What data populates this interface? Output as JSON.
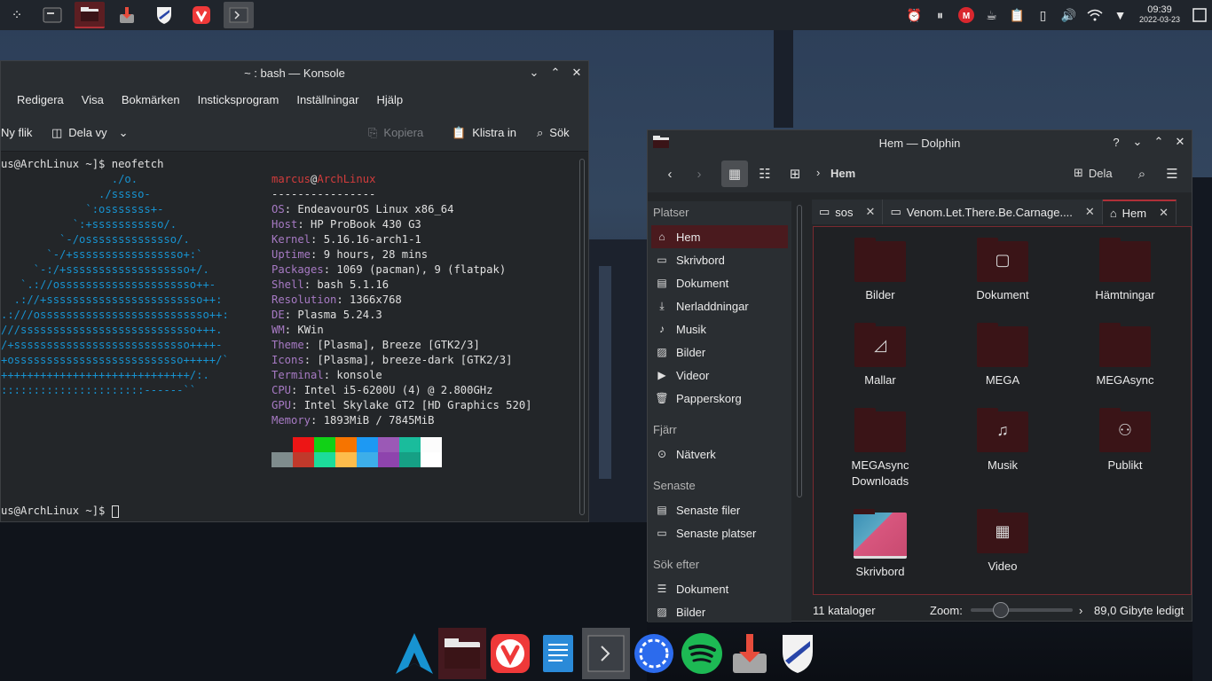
{
  "top_panel": {
    "launcher_icon": "kde-launcher-icon",
    "apps": [
      {
        "name": "terminal-app-icon",
        "active": false
      },
      {
        "name": "dolphin-app-icon",
        "active": true
      },
      {
        "name": "installer-app-icon",
        "active": false
      },
      {
        "name": "shield-app-icon",
        "active": false
      },
      {
        "name": "vivaldi-app-icon",
        "active": false
      },
      {
        "name": "console-app-icon",
        "active": false
      }
    ],
    "tray": [
      "alarm-icon",
      "pause-icon",
      "mega-icon",
      "coffee-icon",
      "clipboard-icon",
      "battery-icon",
      "volume-icon",
      "wifi-icon",
      "arrow-down-icon"
    ],
    "clock_time": "09:39",
    "clock_date": "2022-03-23"
  },
  "konsole": {
    "title": "~ : bash — Konsole",
    "menu": [
      "Redigera",
      "Visa",
      "Bokmärken",
      "Insticksprogram",
      "Inställningar",
      "Hjälp"
    ],
    "toolbar": {
      "new_tab": "Ny flik",
      "split_view": "Dela vy",
      "copy": "Kopiera",
      "paste": "Klistra in",
      "search": "Sök"
    },
    "prompt1": "us@ArchLinux ~]$ neofetch",
    "prompt2": "us@ArchLinux ~]$ ",
    "logo": [
      "                 ./o.",
      "               ./sssso-",
      "             `:osssssss+-",
      "           `:+sssssssssso/.",
      "         `-/ossssssssssssso/.",
      "       `-/+sssssssssssssssso+:`",
      "     `-:/+sssssssssssssssssso+/.",
      "   `.://osssssssssssssssssssso++-",
      "  .://+ssssssssssssssssssssssso++:",
      ".:///ossssssssssssssssssssssssso++:",
      "///sssssssssssssssssssssssssso+++.",
      "/+sssssssssssssssssssssssssso++++-",
      "+ossssssssssssssssssssssssso+++++/`",
      "+++++++++++++++++++++++++++++/:.",
      "::::::::::::::::::::::------``"
    ],
    "user": "marcus",
    "at": "@",
    "host": "ArchLinux",
    "separator": "----------------",
    "info": [
      {
        "key": "OS",
        "value": ": EndeavourOS Linux x86_64"
      },
      {
        "key": "Host",
        "value": ": HP ProBook 430 G3"
      },
      {
        "key": "Kernel",
        "value": ": 5.16.16-arch1-1"
      },
      {
        "key": "Uptime",
        "value": ": 9 hours, 28 mins"
      },
      {
        "key": "Packages",
        "value": ": 1069 (pacman), 9 (flatpak)"
      },
      {
        "key": "Shell",
        "value": ": bash 5.1.16"
      },
      {
        "key": "Resolution",
        "value": ": 1366x768"
      },
      {
        "key": "DE",
        "value": ": Plasma 5.24.3"
      },
      {
        "key": "WM",
        "value": ": KWin"
      },
      {
        "key": "Theme",
        "value": ": [Plasma], Breeze [GTK2/3]"
      },
      {
        "key": "Icons",
        "value": ": [Plasma], breeze-dark [GTK2/3]"
      },
      {
        "key": "Terminal",
        "value": ": konsole"
      },
      {
        "key": "CPU",
        "value": ": Intel i5-6200U (4) @ 2.800GHz"
      },
      {
        "key": "GPU",
        "value": ": Intel Skylake GT2 [HD Graphics 520]"
      },
      {
        "key": "Memory",
        "value": ": 1893MiB / 7845MiB"
      }
    ],
    "palette_top": [
      "#232629",
      "#ed1515",
      "#11d116",
      "#f67400",
      "#1d99f3",
      "#9b59b6",
      "#1abc9c",
      "#fcfcfc"
    ],
    "palette_bottom": [
      "#7f8c8d",
      "#c0392b",
      "#1cdc9a",
      "#fdbc4b",
      "#3daee9",
      "#8e44ad",
      "#16a085",
      "#ffffff"
    ]
  },
  "dolphin": {
    "title": "Hem — Dolphin",
    "location": "Hem",
    "share": "Dela",
    "sidebar": {
      "places_header": "Platser",
      "places": [
        {
          "label": "Hem",
          "icon": "home-icon",
          "selected": true
        },
        {
          "label": "Skrivbord",
          "icon": "desktop-icon",
          "selected": false
        },
        {
          "label": "Dokument",
          "icon": "document-icon",
          "selected": false
        },
        {
          "label": "Nerladdningar",
          "icon": "download-icon",
          "selected": false
        },
        {
          "label": "Musik",
          "icon": "music-icon",
          "selected": false
        },
        {
          "label": "Bilder",
          "icon": "image-icon",
          "selected": false
        },
        {
          "label": "Videor",
          "icon": "video-icon",
          "selected": false
        },
        {
          "label": "Papperskorg",
          "icon": "trash-icon",
          "selected": false
        }
      ],
      "remote_header": "Fjärr",
      "remote": [
        {
          "label": "Nätverk",
          "icon": "network-icon"
        }
      ],
      "recent_header": "Senaste",
      "recent": [
        {
          "label": "Senaste filer",
          "icon": "recent-files-icon"
        },
        {
          "label": "Senaste platser",
          "icon": "recent-places-icon"
        }
      ],
      "search_header": "Sök efter",
      "search": [
        {
          "label": "Dokument",
          "icon": "document-search-icon"
        },
        {
          "label": "Bilder",
          "icon": "image-search-icon"
        }
      ]
    },
    "tabs": [
      {
        "label": "sos",
        "active": false
      },
      {
        "label": "Venom.Let.There.Be.Carnage....",
        "active": false
      },
      {
        "label": "Hem",
        "active": true
      }
    ],
    "folders": [
      {
        "label": "Bilder",
        "symbol": ""
      },
      {
        "label": "Dokument",
        "symbol": "▢"
      },
      {
        "label": "Hämtningar",
        "symbol": ""
      },
      {
        "label": "Mallar",
        "symbol": "◿"
      },
      {
        "label": "MEGA",
        "symbol": ""
      },
      {
        "label": "MEGAsync",
        "symbol": ""
      },
      {
        "label": "MEGAsync Downloads",
        "symbol": ""
      },
      {
        "label": "Musik",
        "symbol": "♫"
      },
      {
        "label": "Publikt",
        "symbol": "⚇"
      },
      {
        "label": "Skrivbord",
        "symbol": ""
      },
      {
        "label": "Video",
        "symbol": "▦"
      }
    ],
    "status": {
      "count": "11 kataloger",
      "zoom_label": "Zoom:",
      "free": "89,0 Gibyte ledigt",
      "zoom_level": 0.22
    }
  },
  "dock": [
    "arch-icon",
    "dolphin-dock-icon",
    "vivaldi-dock-icon",
    "writer-dock-icon",
    "terminal-dock-icon",
    "signal-dock-icon",
    "spotify-dock-icon",
    "installer-dock-icon",
    "shield-dock-icon"
  ]
}
